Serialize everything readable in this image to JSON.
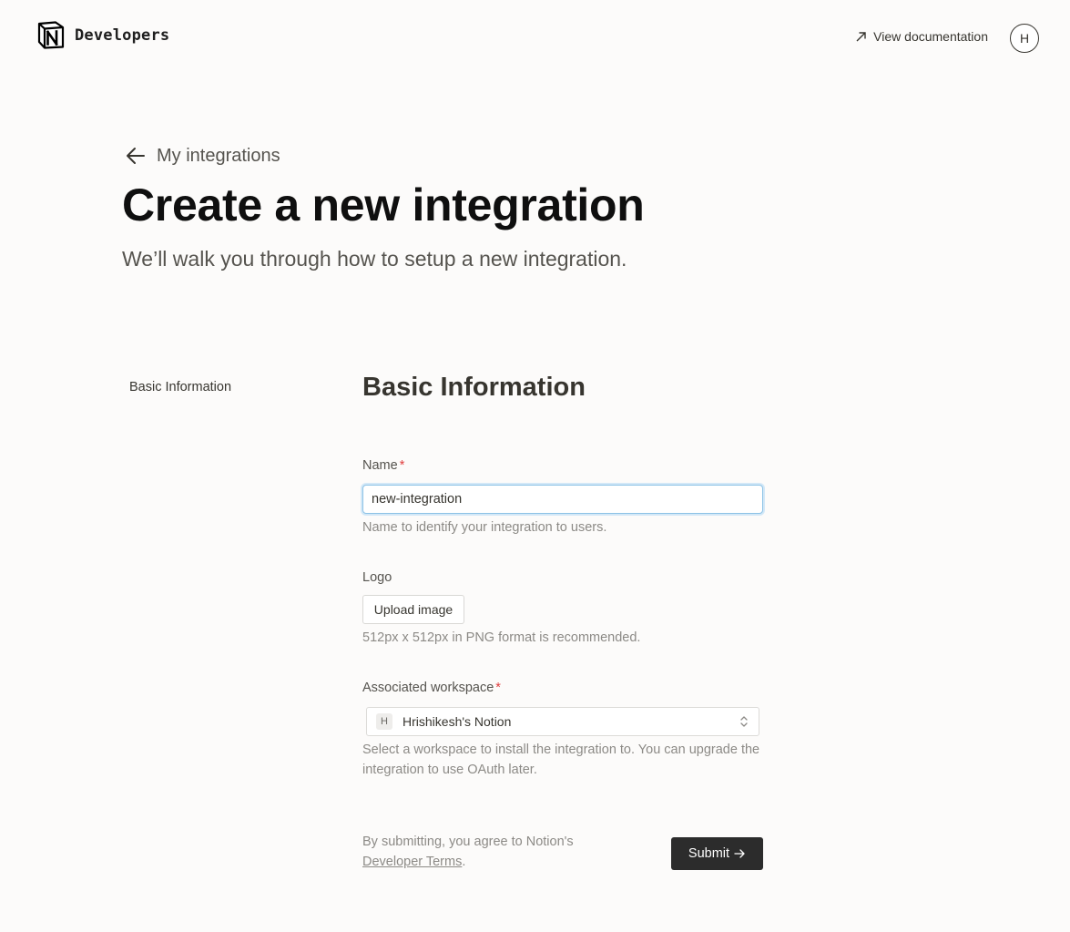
{
  "header": {
    "brand": "Developers",
    "doc_link": "View documentation",
    "avatar_initial": "H"
  },
  "back_link": {
    "label": "My integrations"
  },
  "page": {
    "title": "Create a new integration",
    "subtitle": "We’ll walk you through how to setup a new integration."
  },
  "side_nav": {
    "items": [
      {
        "label": "Basic Information"
      }
    ]
  },
  "section": {
    "title": "Basic Information"
  },
  "form": {
    "name": {
      "label": "Name",
      "required_mark": "*",
      "value": "new-integration",
      "help": "Name to identify your integration to users."
    },
    "logo": {
      "label": "Logo",
      "button": "Upload image",
      "help": "512px x 512px in PNG format is recommended."
    },
    "workspace": {
      "label": "Associated workspace",
      "required_mark": "*",
      "badge": "H",
      "selected": "Hrishikesh's Notion",
      "help": "Select a workspace to install the integration to. You can upgrade the integration to use OAuth later."
    },
    "terms": {
      "prefix": "By submitting, you agree to Notion's",
      "link": "Developer Terms",
      "suffix": "."
    },
    "submit": "Submit"
  },
  "colors": {
    "background": "#fcfbfa",
    "required": "#e03e3e",
    "focus_border": "#8cc2e6",
    "submit_bg": "#2c2c2c"
  },
  "icons": [
    "notion-logo-icon",
    "arrow-up-right-icon",
    "arrow-left-icon",
    "chevron-updown-icon",
    "arrow-right-icon"
  ]
}
